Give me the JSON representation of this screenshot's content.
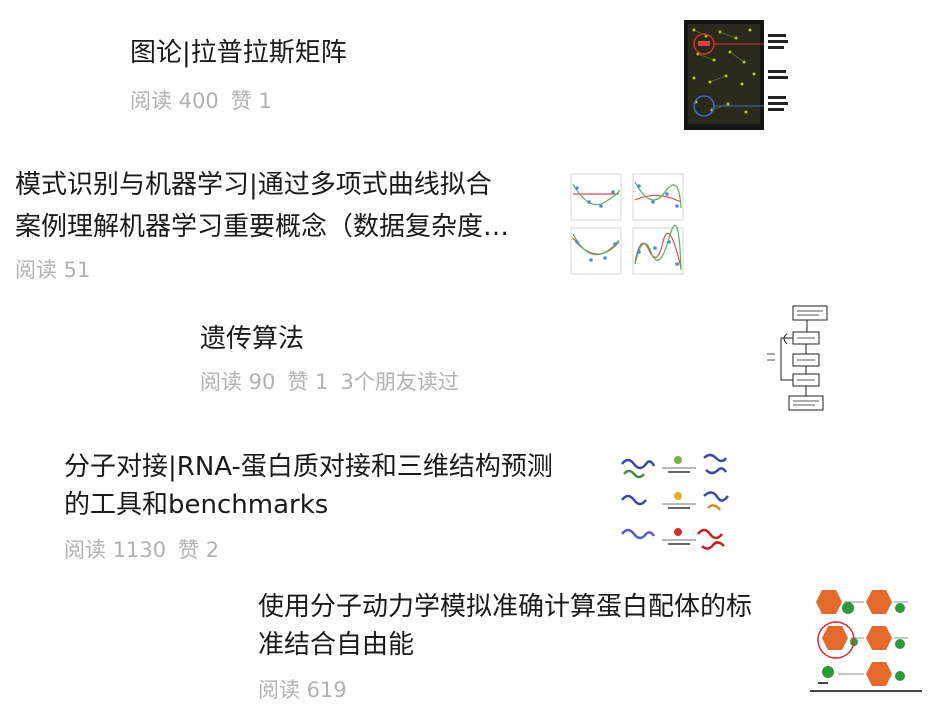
{
  "articles": [
    {
      "title": "图论|拉普拉斯矩阵",
      "reads": "阅读 400",
      "likes": "赞 1"
    },
    {
      "title_line1": "模式识别与机器学习|通过多项式曲线拟合",
      "title_line2": "案例理解机器学习重要概念（数据复杂度…",
      "reads": "阅读 51"
    },
    {
      "title": "遗传算法",
      "reads": "阅读 90",
      "likes": "赞 1",
      "friends": "3个朋友读过"
    },
    {
      "title_line1": "分子对接|RNA-蛋白质对接和三维结构预测",
      "title_line2": "的工具和benchmarks",
      "reads": "阅读 1130",
      "likes": "赞 2"
    },
    {
      "title_line1": "使用分子动力学模拟准确计算蛋白配体的标",
      "title_line2": "准结合自由能",
      "reads": "阅读 619"
    }
  ]
}
